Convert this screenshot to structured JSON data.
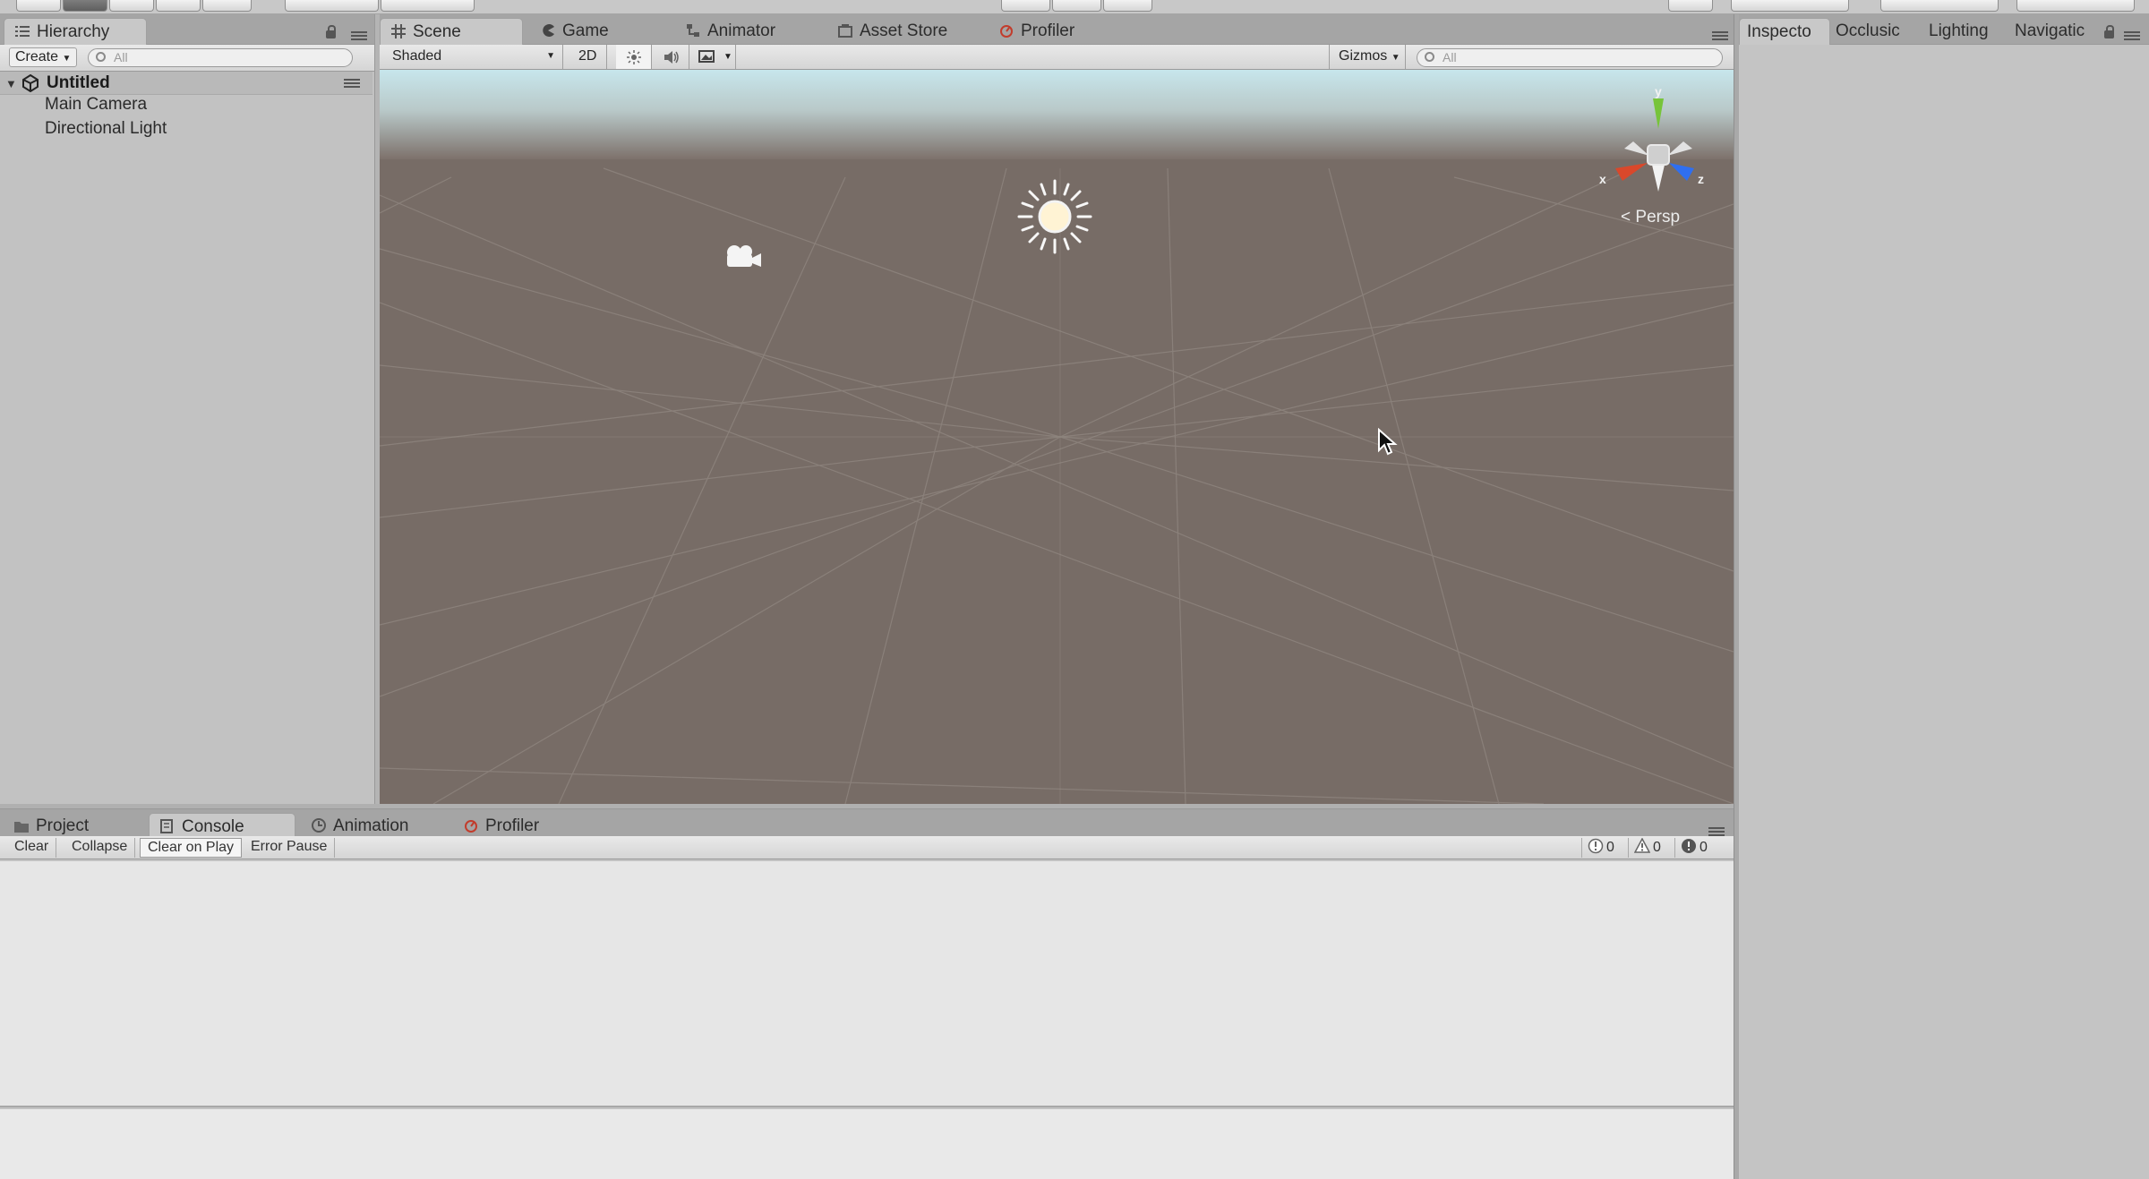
{
  "colors": {
    "panel": "#c2c2c2",
    "tabstrip": "#a5a5a5",
    "scene_ground": "#776c66",
    "sky": "#c7e4ea",
    "console_bg": "#e6e6e6",
    "gizmo_x": "#d9482b",
    "gizmo_y": "#77c43a",
    "gizmo_z": "#2f6ff0"
  },
  "hierarchy": {
    "tab_label": "Hierarchy",
    "create_label": "Create",
    "search_placeholder": "All",
    "scene_name": "Untitled",
    "items": [
      {
        "label": "Main Camera"
      },
      {
        "label": "Directional Light"
      }
    ]
  },
  "scene_view": {
    "tabs": [
      {
        "label": "Scene",
        "icon": "grid-icon"
      },
      {
        "label": "Game",
        "icon": "pacman-icon"
      },
      {
        "label": "Animator",
        "icon": "animator-icon"
      },
      {
        "label": "Asset Store",
        "icon": "store-icon"
      },
      {
        "label": "Profiler",
        "icon": "profiler-icon"
      }
    ],
    "shading_mode": "Shaded",
    "mode_2d_label": "2D",
    "gizmos_label": "Gizmos",
    "search_placeholder": "All",
    "gizmo": {
      "x_label": "x",
      "y_label": "y",
      "z_label": "z",
      "projection_label": "Persp"
    }
  },
  "inspector": {
    "tabs": [
      {
        "label": "Inspecto"
      },
      {
        "label": "Occlusic"
      },
      {
        "label": "Lighting"
      },
      {
        "label": "Navigatic"
      }
    ]
  },
  "bottom": {
    "tabs": [
      {
        "label": "Project",
        "icon": "folder-icon"
      },
      {
        "label": "Console",
        "icon": "console-icon"
      },
      {
        "label": "Animation",
        "icon": "clock-icon"
      },
      {
        "label": "Profiler",
        "icon": "profiler-icon"
      }
    ],
    "console_buttons": [
      {
        "label": "Clear"
      },
      {
        "label": "Collapse"
      },
      {
        "label": "Clear on Play"
      },
      {
        "label": "Error Pause"
      }
    ],
    "counts": {
      "info": "0",
      "warning": "0",
      "error": "0"
    }
  }
}
